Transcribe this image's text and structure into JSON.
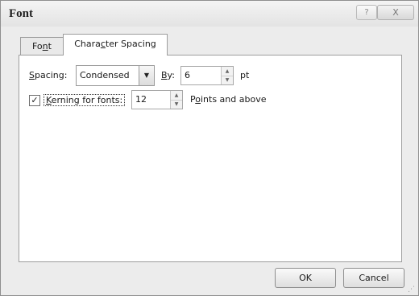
{
  "window": {
    "title": "Font",
    "help_glyph": "?",
    "close_glyph": "X"
  },
  "tabs": [
    {
      "label_pre": "Fo",
      "label_accel": "n",
      "label_post": "t",
      "selected": false
    },
    {
      "label_pre": "Chara",
      "label_accel": "c",
      "label_post": "ter Spacing",
      "selected": true
    }
  ],
  "spacing": {
    "label_pre": "",
    "label_accel": "S",
    "label_post": "pacing:",
    "value": "Condensed",
    "by_label_pre": "",
    "by_label_accel": "B",
    "by_label_post": "y:",
    "by_value": "6",
    "unit": "pt"
  },
  "kerning": {
    "checked": true,
    "label_pre": "",
    "label_accel": "K",
    "label_post": "erning for fonts:",
    "value": "12",
    "suffix_pre": "P",
    "suffix_accel": "o",
    "suffix_post": "ints and above"
  },
  "buttons": {
    "ok": "OK",
    "cancel": "Cancel"
  },
  "icons": {
    "checkbox_mark": "✓",
    "dropdown_arrow": "▼",
    "spin_up": "▲",
    "spin_down": "▼",
    "resize_grip": "⋰"
  }
}
